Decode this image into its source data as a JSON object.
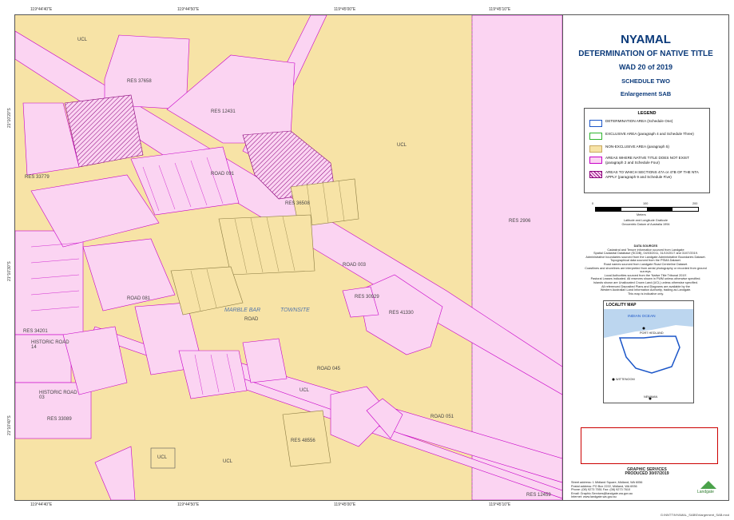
{
  "header": {
    "title": "NYAMAL",
    "subtitle": "DETERMINATION OF NATIVE TITLE",
    "case": "WAD 20 of 2019",
    "schedule": "SCHEDULE TWO",
    "enlargement": "Enlargement SAB"
  },
  "legend": {
    "heading": "LEGEND",
    "items": [
      {
        "label": "DETERMINATION AREA  (Schedule One)",
        "color": "#ffffff",
        "border": "#1a55c8"
      },
      {
        "label": "EXCLUSIVE AREA (paragraph 4 and Schedule Three)",
        "color": "#ffffff",
        "border": "#2fb52f"
      },
      {
        "label": "NON-EXCLUSIVE AREA (paragraph 5)",
        "color": "#f7e3a6",
        "border": "#c8a860"
      },
      {
        "label": "AREAS WHERE NATIVE TITLE DOES NOT EXIST (paragraph 2 and Schedule Four)",
        "color": "#fbd4f2",
        "border": "#c800c8"
      },
      {
        "label": "AREAS TO WHICH SECTIONS 47A or 47B OF THE NTA APPLY (paragraph 9 and Schedule Five)",
        "color": "#fbd4f2",
        "border": "#8a007a",
        "hatch": true
      }
    ]
  },
  "scale": {
    "ticks": [
      "0",
      "100",
      "200"
    ],
    "unit": "Meters"
  },
  "projection": [
    "Latitude and Longitude Graticule",
    "Geocentric Datum of Australia 1994"
  ],
  "data_sources": {
    "heading": "DATA SOURCES",
    "lines": [
      "Cadastral and Tenure information sourced from Landgate",
      "Spatial Cadastral Database (SCDB), 04/03/2011, 31/10/2017 and 31/07/2019.",
      "Administrative boundaries sourced from the Landgate Administrative Boundaries Dataset.",
      "Topographical data sourced from the PSMA Dataset.",
      "Road names sourced from Landgate Road Centreline Dataset.",
      "Coastlines and shorelines are interpreted from aerial photography or recorded from ground surveys.",
      "Local Authorities sourced from the 'Native Title Tribunal 2019'.",
      "Pastoral Leases indicated. All reserves shown in FWM unless otherwise specified.",
      "Islands shown are Unallocated Crown Land (UCL) unless otherwise specified.",
      "All referenced Deposited Plans and Diagrams are available by the",
      "Western Australian Land Information Authority, trading as Landgate.",
      "This map is indicative only."
    ]
  },
  "locality": {
    "heading": "LOCALITY MAP",
    "ocean": "INDIAN OCEAN",
    "towns": [
      "PORT HEDLAND",
      "WITTENOOM",
      "NEWMAN"
    ]
  },
  "graphic_services": {
    "title": "GRAPHIC SERVICES",
    "produced": "PRODUCED 30/07/2019",
    "address": [
      "Street address: 1 Midland Square, Midland, WA 6056",
      "Postal address: PO Box 2222, Midland, WA 6936",
      "Phone: (08) 9273 7551   Fax: (08) 9273 7610",
      "Email: Graphic.Services@landgate.wa.gov.au",
      "Internet: www.landgate.wa.gov.au"
    ],
    "brand": "Landgate"
  },
  "grid": {
    "lon_top": [
      "119°44'40\"E",
      "119°44'50\"E",
      "119°45'00\"E",
      "119°45'10\"E"
    ],
    "lat_left": [
      "21°10'20\"S",
      "21°10'30\"S",
      "21°10'40\"S",
      "21°10'50\"S"
    ]
  },
  "map_labels": {
    "ucl": "UCL",
    "res_37658": "RES 37658",
    "res_12431": "RES 12431",
    "res_2906": "RES 2906",
    "res_41330": "RES 41330",
    "res_30929": "RES 30929",
    "res_36508": "RES 36508",
    "res_34201": "RES 34201",
    "res_33089": "RES 33089",
    "res_48556": "RES 48556",
    "res_33779": "RES 33779",
    "res_12459": "RES 12459",
    "road_003": "ROAD 003",
    "road_045": "ROAD 045",
    "road_051": "ROAD 051",
    "road_091": "ROAD 091",
    "road_081": "ROAD 081",
    "historic_14": "HISTORIC ROAD 14",
    "historic_03": "HISTORIC ROAD 03",
    "townsite_1": "MARBLE BAR",
    "townsite_2": "TOWNSITE",
    "road": "ROAD"
  },
  "footer": "G:\\NNTT\\NYAMAL_SAB\\Enlargement_SAB.mxd"
}
